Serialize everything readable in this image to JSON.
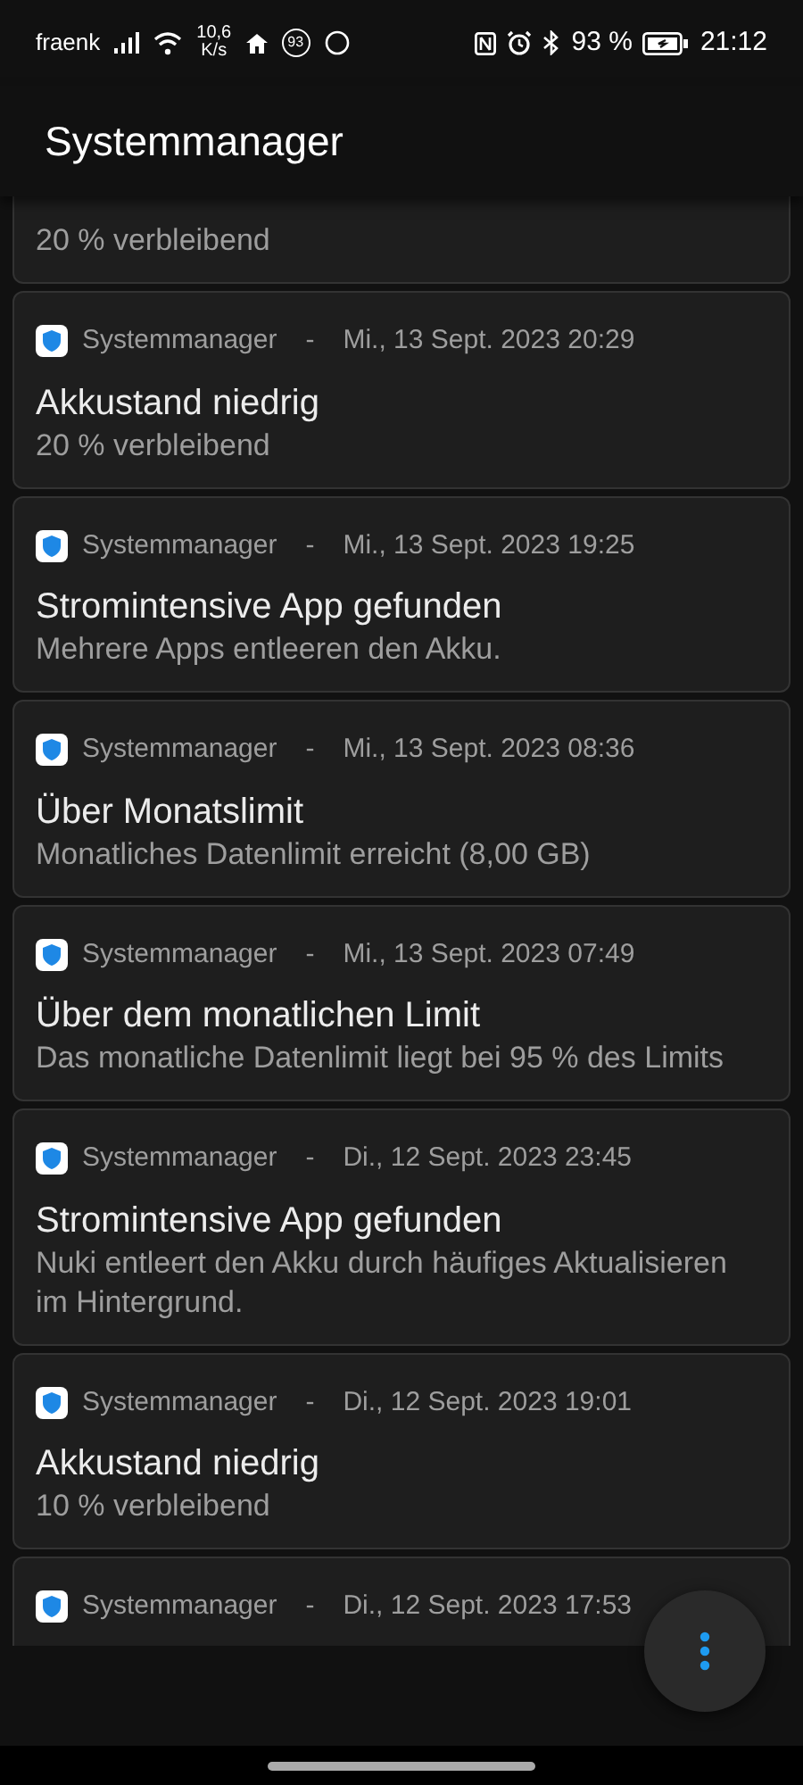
{
  "status_bar": {
    "carrier": "fraenk",
    "speed_value": "10,6",
    "speed_unit": "K/s",
    "badge": "93",
    "battery_percent": "93 %",
    "time": "21:12"
  },
  "app_bar": {
    "title": "Systemmanager"
  },
  "notifications": [
    {
      "kind": "cut_top",
      "body": "20 % verbleibend"
    },
    {
      "kind": "full",
      "app": "Systemmanager",
      "separator": "-",
      "date": "Mi., 13 Sept. 2023 20:29",
      "title": "Akkustand niedrig",
      "body": "20 % verbleibend"
    },
    {
      "kind": "full",
      "app": "Systemmanager",
      "separator": "-",
      "date": "Mi., 13 Sept. 2023 19:25",
      "title": "Stromintensive App gefunden",
      "body": "Mehrere Apps entleeren den Akku."
    },
    {
      "kind": "full",
      "app": "Systemmanager",
      "separator": "-",
      "date": "Mi., 13 Sept. 2023 08:36",
      "title": "Über Monatslimit",
      "body": "Monatliches Datenlimit erreicht (8,00 GB)"
    },
    {
      "kind": "full",
      "app": "Systemmanager",
      "separator": "-",
      "date": "Mi., 13 Sept. 2023 07:49",
      "title": "Über dem monatlichen Limit",
      "body": "Das monatliche Datenlimit liegt bei 95 % des Limits"
    },
    {
      "kind": "full",
      "app": "Systemmanager",
      "separator": "-",
      "date": "Di., 12 Sept. 2023 23:45",
      "title": "Stromintensive App gefunden",
      "body": "Nuki entleert den Akku durch häufiges Aktualisieren im Hintergrund."
    },
    {
      "kind": "full",
      "app": "Systemmanager",
      "separator": "-",
      "date": "Di., 12 Sept. 2023 19:01",
      "title": "Akkustand niedrig",
      "body": "10 % verbleibend"
    },
    {
      "kind": "cut_bottom",
      "app": "Systemmanager",
      "separator": "-",
      "date": "Di., 12 Sept. 2023 17:53"
    }
  ]
}
